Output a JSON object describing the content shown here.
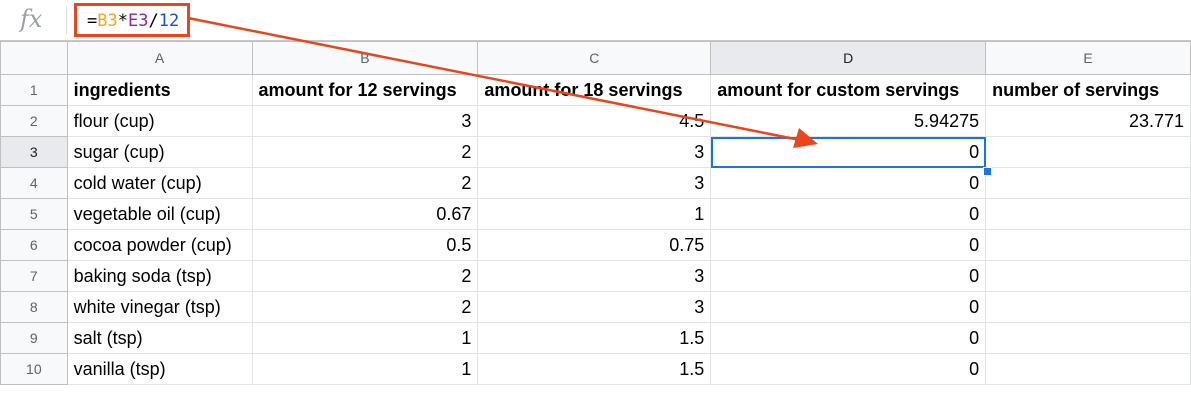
{
  "formula_bar": {
    "icon": "fx-icon",
    "parts": {
      "eq": "=",
      "ref1": "B3",
      "op1": "*",
      "ref2": "E3",
      "op2": "/",
      "num": "12"
    }
  },
  "columns": [
    "A",
    "B",
    "C",
    "D",
    "E"
  ],
  "rows": [
    {
      "n": "1",
      "cells": [
        "ingredients",
        "amount for 12 servings",
        "amount for 18 servings",
        "amount for custom servings",
        "number of servings"
      ]
    },
    {
      "n": "2",
      "cells": [
        "flour (cup)",
        "3",
        "4.5",
        "5.94275",
        "23.771"
      ]
    },
    {
      "n": "3",
      "cells": [
        "sugar (cup)",
        "2",
        "3",
        "0",
        ""
      ]
    },
    {
      "n": "4",
      "cells": [
        "cold water (cup)",
        "2",
        "3",
        "0",
        ""
      ]
    },
    {
      "n": "5",
      "cells": [
        "vegetable oil (cup)",
        "0.67",
        "1",
        "0",
        ""
      ]
    },
    {
      "n": "6",
      "cells": [
        "cocoa powder (cup)",
        "0.5",
        "0.75",
        "0",
        ""
      ]
    },
    {
      "n": "7",
      "cells": [
        "baking soda (tsp)",
        "2",
        "3",
        "0",
        ""
      ]
    },
    {
      "n": "8",
      "cells": [
        "white vinegar (tsp)",
        "2",
        "3",
        "0",
        ""
      ]
    },
    {
      "n": "9",
      "cells": [
        "salt (tsp)",
        "1",
        "1.5",
        "0",
        ""
      ]
    },
    {
      "n": "10",
      "cells": [
        "vanilla (tsp)",
        "1",
        "1.5",
        "0",
        ""
      ]
    }
  ],
  "selected_cell": "D3",
  "colors": {
    "annotation": "#e8461f",
    "selection": "#1a73e8"
  }
}
